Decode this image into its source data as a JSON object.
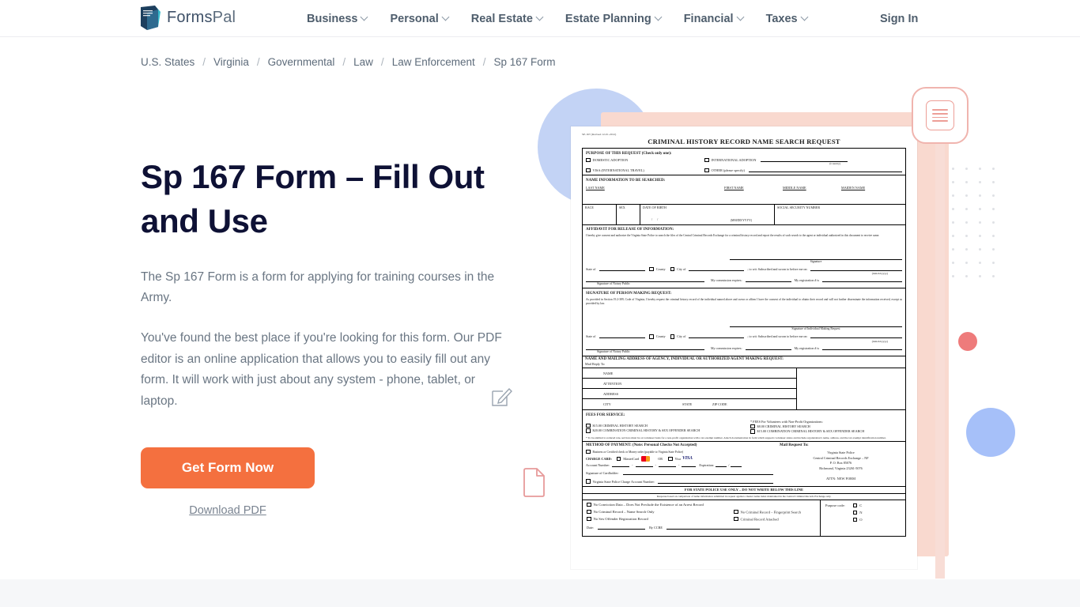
{
  "header": {
    "logo_text_prefix": "Forms",
    "logo_text_suffix": "Pal",
    "logo_icon": "formspal-logo-icon",
    "nav": [
      {
        "label": "Business",
        "has_caret": true
      },
      {
        "label": "Personal",
        "has_caret": true
      },
      {
        "label": "Real Estate",
        "has_caret": true
      },
      {
        "label": "Estate Planning",
        "has_caret": true
      },
      {
        "label": "Financial",
        "has_caret": true
      },
      {
        "label": "Taxes",
        "has_caret": true
      }
    ],
    "sign_in": "Sign In"
  },
  "breadcrumb": {
    "separator": "/",
    "items": [
      "U.S. States",
      "Virginia",
      "Governmental",
      "Law",
      "Law Enforcement",
      "Sp 167 Form"
    ]
  },
  "hero": {
    "title": "Sp 167 Form – Fill Out and Use",
    "paragraph_1": "The Sp 167 Form is a form for applying for training courses in the Army.",
    "paragraph_2": "You've found the best place if you're looking for this form. Our PDF editor is an online application that allows you to easily fill out any form. It will work with just about any system - phone, tablet, or laptop.",
    "cta_label": "Get Form Now",
    "download_label": "Download PDF"
  },
  "decor": {
    "pencil_icon": "pencil-edit-icon",
    "document_outline_icon": "document-outline-icon",
    "badge_icon": "document-lines-badge-icon",
    "accent_orange": "#f4703f",
    "accent_pink": "#f8ddd6",
    "accent_red": "#ee7b7b",
    "accent_blue": "#a6c0f9",
    "accent_light_blue": "#c3d3f5",
    "accent_peach": "#f9d9cf"
  },
  "form_preview": {
    "revision": "SP-167 (Revised 12-01-2012)",
    "title": "CRIMINAL HISTORY RECORD NAME SEARCH REQUEST",
    "purpose": {
      "heading": "PURPOSE OF THIS REQUEST (Check only one):",
      "options": [
        "DOMESTIC ADOPTION",
        "INTERNATIONAL ADOPTION",
        "VISA (INTERNATIONAL TRAVEL)",
        "OTHER (please specify)"
      ],
      "country_label": "(Country)"
    },
    "name_info": {
      "heading": "NAME INFORMATION TO BE SEARCHED:",
      "columns": [
        "LAST NAME",
        "FIRST NAME",
        "MIDDLE NAME",
        "MAIDEN NAME"
      ],
      "row2": [
        "RACE",
        "SEX",
        "DATE OF BIRTH",
        "SOCIAL SECURITY NUMBER"
      ],
      "dob_format": "(MM/DD/YYYY)"
    },
    "affidavit": {
      "heading": "AFFIDAVIT FOR RELEASE OF INFORMATION:",
      "body": "I hereby give consent and authorize the Virginia State Police to search the files of the Central Criminal Records Exchange for a criminal history record and report the results of such search to the agent or individual authorized in this document to receive same.",
      "signature_label": "Signature",
      "state_of": "State of",
      "county": "County",
      "city_of": "City of",
      "to_wit": "; to wit:  Subscribed and sworn to before me on:",
      "date_format": "(mm/dd/yyyy)",
      "notary_label": "Signature of Notary Public",
      "commission_expires": "My commission expires:",
      "registration": "My registration # is"
    },
    "signature_section": {
      "heading": "SIGNATURE OF PERSON MAKING REQUEST:",
      "body": "As provided in Section 19.2-389, Code of Virginia, I hereby request the criminal history record of the individual named above and swear or affirm I have the consent of the individual to obtain their record and will not further disseminate the information received, except as provided by law.",
      "signature_label": "Signature of Individual Making Request"
    },
    "mailing": {
      "heading": "NAME AND MAILING ADDRESS OF AGENCY, INDIVIDUAL OR AUTHORIZED AGENT MAKING REQUEST:",
      "mail_reply_to": "Mail Reply To:",
      "rows": [
        "NAME",
        "ATTENTION",
        "ADDRESS"
      ],
      "city_row": [
        "CITY",
        "STATE",
        "ZIP CODE"
      ]
    },
    "fees": {
      "heading": "FEES FOR SERVICE:",
      "left_options": [
        "$15.00 CRIMINAL HISTORY SEARCH",
        "$20.00 COMBINATION CRIMINAL HISTORY & SEX OFFENDER SEARCH"
      ],
      "right_heading": "* FEES For Volunteers with Non-Profit Organizations:",
      "right_options": [
        "$8.00 CRIMINAL HISTORY SEARCH",
        "$15.00 COMBINATION CRIMINAL HISTORY & SEX OFFENDER SEARCH"
      ],
      "footnote": "* To be entitled to reduced rate, services must be on volunteer basis for a non-profit organization with a tax exempt number. Attach documentation in form which supports volunteer status and include organization's name, address, and the tax exempt identification number."
    },
    "payment": {
      "heading": "METHOD OF PAYMENT: (Note: Personal Checks Not Accepted)",
      "not_word": "Not",
      "option_business": "Business or Certified check or Money order (payable to Virginia State Police)",
      "charge_card_label": "CHARGE CARD:",
      "mastercard": "MasterCard",
      "or_label": "OR",
      "visa": "Visa",
      "visa_logo": "VISA",
      "account_number": "Account Number:",
      "expiration": "Expiration:",
      "signature_cardholder": "Signature of Cardholder:",
      "vsp_account": "Virginia State Police Charge Account Number:",
      "mail_request_heading": "Mail Request To:",
      "mail_address": [
        "Virginia State Police",
        "Central Criminal Records Exchange – NF",
        "P. O. Box 85076",
        "Richmond, Virginia 23261-5076"
      ],
      "attn": "ATTN:  NEW FORM"
    },
    "police_use": {
      "banner": "FOR STATE POLICE USE ONLY – DO NOT WRITE BELOW THIS LINE",
      "response_note": "Response based on comparison of name information submitted in request against a master name index maintained in the Central Criminal Records Exchange only.",
      "checks_left": [
        "No Conviction Data – Does Not Preclude the Existence of an Arrest Record",
        "No Criminal Record – Name Search Only",
        "No Sex Offender Registration  Record"
      ],
      "checks_right": [
        "No Criminal Record – Fingerprint Search",
        "Criminal Record Attached"
      ],
      "date_label": "Date:",
      "ccre_label": "By CCRE",
      "purpose_code_label": "Purpose code:",
      "purpose_codes": [
        "C",
        "N",
        "O"
      ]
    }
  }
}
